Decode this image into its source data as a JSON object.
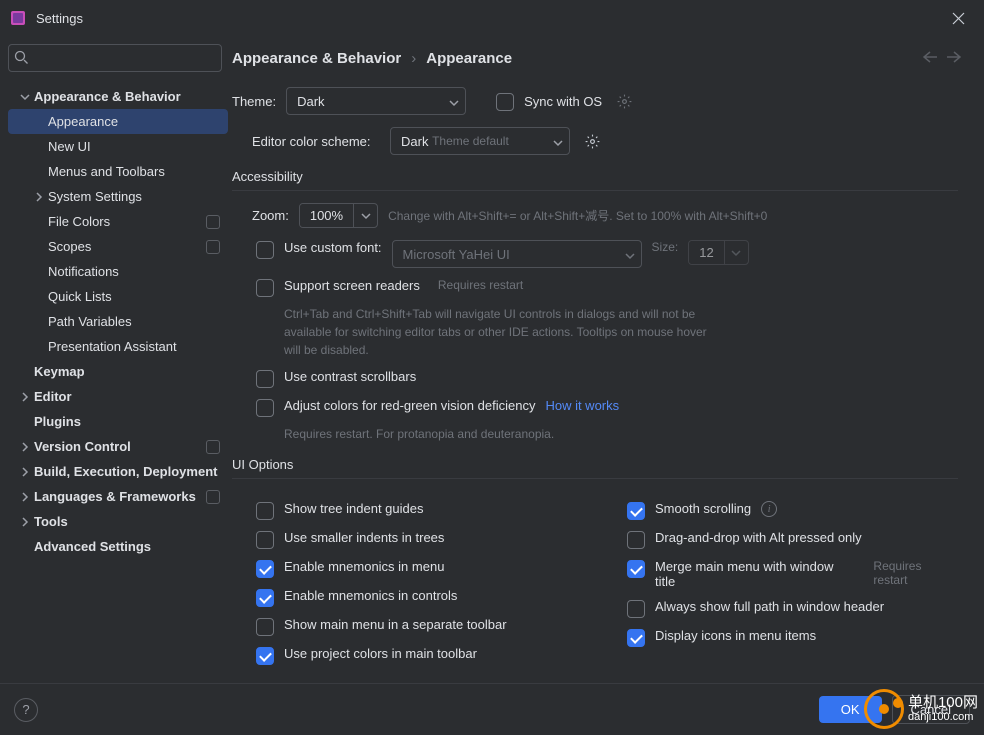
{
  "window": {
    "title": "Settings"
  },
  "search": {
    "placeholder": ""
  },
  "sidebar": {
    "items": [
      {
        "label": "Appearance & Behavior",
        "level": 0,
        "expanded": true
      },
      {
        "label": "Appearance",
        "level": 1,
        "selected": true
      },
      {
        "label": "New UI",
        "level": 1
      },
      {
        "label": "Menus and Toolbars",
        "level": 1
      },
      {
        "label": "System Settings",
        "level": 1,
        "haschev": true
      },
      {
        "label": "File Colors",
        "level": 1,
        "badge": true
      },
      {
        "label": "Scopes",
        "level": 1,
        "badge": true
      },
      {
        "label": "Notifications",
        "level": 1
      },
      {
        "label": "Quick Lists",
        "level": 1
      },
      {
        "label": "Path Variables",
        "level": 1
      },
      {
        "label": "Presentation Assistant",
        "level": 1
      },
      {
        "label": "Keymap",
        "level": 0,
        "nochev": true
      },
      {
        "label": "Editor",
        "level": 0,
        "haschev": true
      },
      {
        "label": "Plugins",
        "level": 0,
        "nochev": true
      },
      {
        "label": "Version Control",
        "level": 0,
        "haschev": true,
        "badge": true
      },
      {
        "label": "Build, Execution, Deployment",
        "level": 0,
        "haschev": true
      },
      {
        "label": "Languages & Frameworks",
        "level": 0,
        "haschev": true,
        "badge": true
      },
      {
        "label": "Tools",
        "level": 0,
        "haschev": true
      },
      {
        "label": "Advanced Settings",
        "level": 0,
        "nochev": true
      }
    ]
  },
  "breadcrumb": {
    "parent": "Appearance & Behavior",
    "current": "Appearance"
  },
  "theme": {
    "label": "Theme:",
    "value": "Dark",
    "sync_label": "Sync with OS"
  },
  "scheme": {
    "label": "Editor color scheme:",
    "value": "Dark",
    "suffix": "Theme default"
  },
  "sections": {
    "accessibility": "Accessibility",
    "ui_options": "UI Options"
  },
  "zoom": {
    "label": "Zoom:",
    "value": "100%",
    "hint": "Change with Alt+Shift+= or Alt+Shift+减号. Set to 100% with Alt+Shift+0"
  },
  "font": {
    "checkbox": "Use custom font:",
    "value": "Microsoft YaHei UI",
    "size_label": "Size:",
    "size_value": "12"
  },
  "screen_readers": {
    "label": "Support screen readers",
    "restart": "Requires restart",
    "desc": "Ctrl+Tab and Ctrl+Shift+Tab will navigate UI controls in dialogs and will not be available for switching editor tabs or other IDE actions. Tooltips on mouse hover will be disabled."
  },
  "contrast": {
    "label": "Use contrast scrollbars"
  },
  "color_def": {
    "label": "Adjust colors for red-green vision deficiency",
    "link": "How it works",
    "desc": "Requires restart. For protanopia and deuteranopia."
  },
  "ui_opts": {
    "left": [
      {
        "key": "tree_guides",
        "label": "Show tree indent guides",
        "checked": false
      },
      {
        "key": "small_indents",
        "label": "Use smaller indents in trees",
        "checked": false
      },
      {
        "key": "mnem_menu",
        "label": "Enable mnemonics in menu",
        "checked": true
      },
      {
        "key": "mnem_ctrl",
        "label": "Enable mnemonics in controls",
        "checked": true
      },
      {
        "key": "sep_toolbar",
        "label": "Show main menu in a separate toolbar",
        "checked": false
      },
      {
        "key": "proj_colors",
        "label": "Use project colors in main toolbar",
        "checked": true
      }
    ],
    "right": [
      {
        "key": "smooth",
        "label": "Smooth scrolling",
        "checked": true,
        "info": true
      },
      {
        "key": "dnd_alt",
        "label": "Drag-and-drop with Alt pressed only",
        "checked": false
      },
      {
        "key": "merge_menu",
        "label": "Merge main menu with window title",
        "checked": true,
        "hint": "Requires restart"
      },
      {
        "key": "full_path",
        "label": "Always show full path in window header",
        "checked": false
      },
      {
        "key": "icons_menu",
        "label": "Display icons in menu items",
        "checked": true
      }
    ]
  },
  "footer": {
    "ok": "OK",
    "cancel": "Cancel"
  },
  "watermark": {
    "line1": "单机100网",
    "line2": "danji100.com"
  }
}
